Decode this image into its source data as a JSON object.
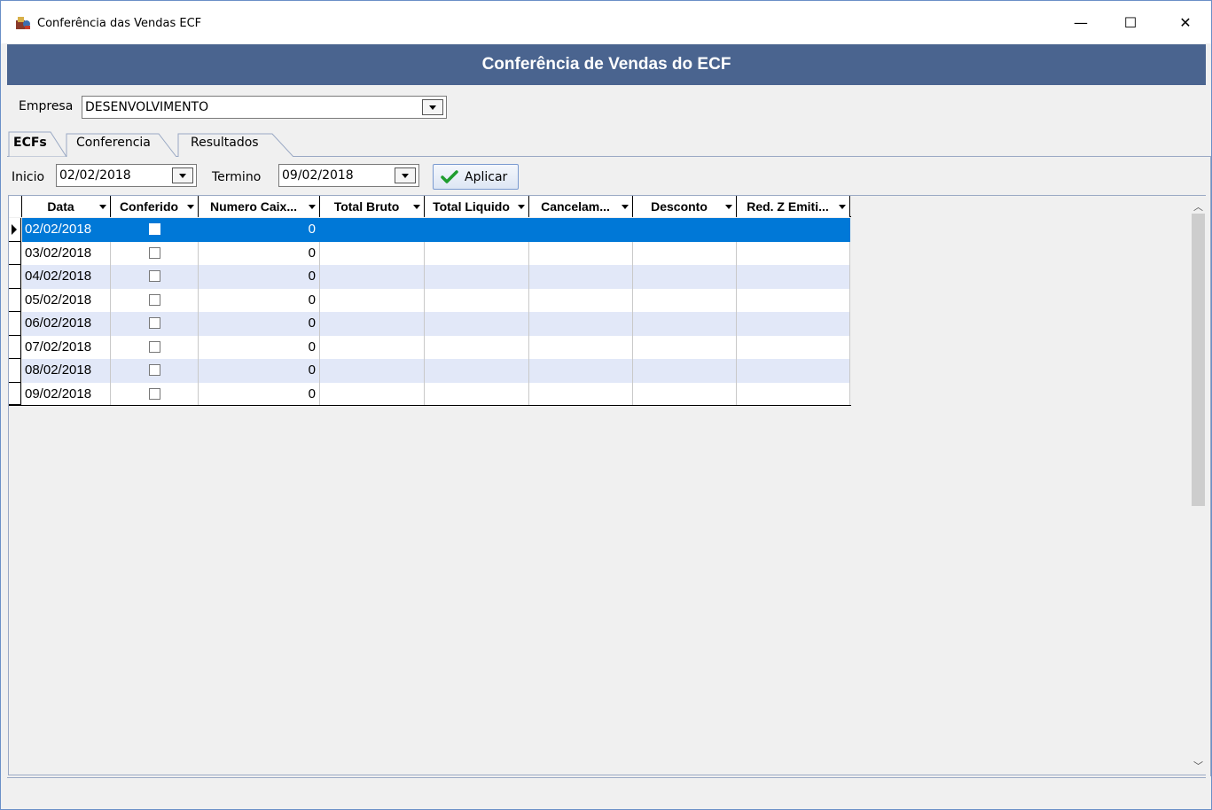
{
  "window": {
    "title": "Conferência das Vendas ECF",
    "min": "—",
    "max": "☐",
    "close": "✕"
  },
  "header": {
    "title": "Conferência de Vendas do ECF"
  },
  "empresa": {
    "label": "Empresa",
    "value": "DESENVOLVIMENTO"
  },
  "tabs": [
    {
      "label": "ECFs",
      "active": true
    },
    {
      "label": "Conferencia",
      "active": false
    },
    {
      "label": "Resultados",
      "active": false
    }
  ],
  "filters": {
    "inicio_label": "Inicio",
    "inicio_value": "02/02/2018",
    "termino_label": "Termino",
    "termino_value": "09/02/2018",
    "apply_label": "Aplicar"
  },
  "grid": {
    "columns": [
      "Data",
      "Conferido",
      "Numero Caix...",
      "Total Bruto",
      "Total Liquido",
      "Cancelam...",
      "Desconto",
      "Red. Z Emiti..."
    ],
    "rows": [
      {
        "data": "02/02/2018",
        "numero": "0"
      },
      {
        "data": "03/02/2018",
        "numero": "0"
      },
      {
        "data": "04/02/2018",
        "numero": "0"
      },
      {
        "data": "05/02/2018",
        "numero": "0"
      },
      {
        "data": "06/02/2018",
        "numero": "0"
      },
      {
        "data": "07/02/2018",
        "numero": "0"
      },
      {
        "data": "08/02/2018",
        "numero": "0"
      },
      {
        "data": "09/02/2018",
        "numero": "0"
      }
    ]
  },
  "colors": {
    "banner": "#4a648f",
    "selection": "#0078d7",
    "alt_row": "#e2e8f8"
  }
}
